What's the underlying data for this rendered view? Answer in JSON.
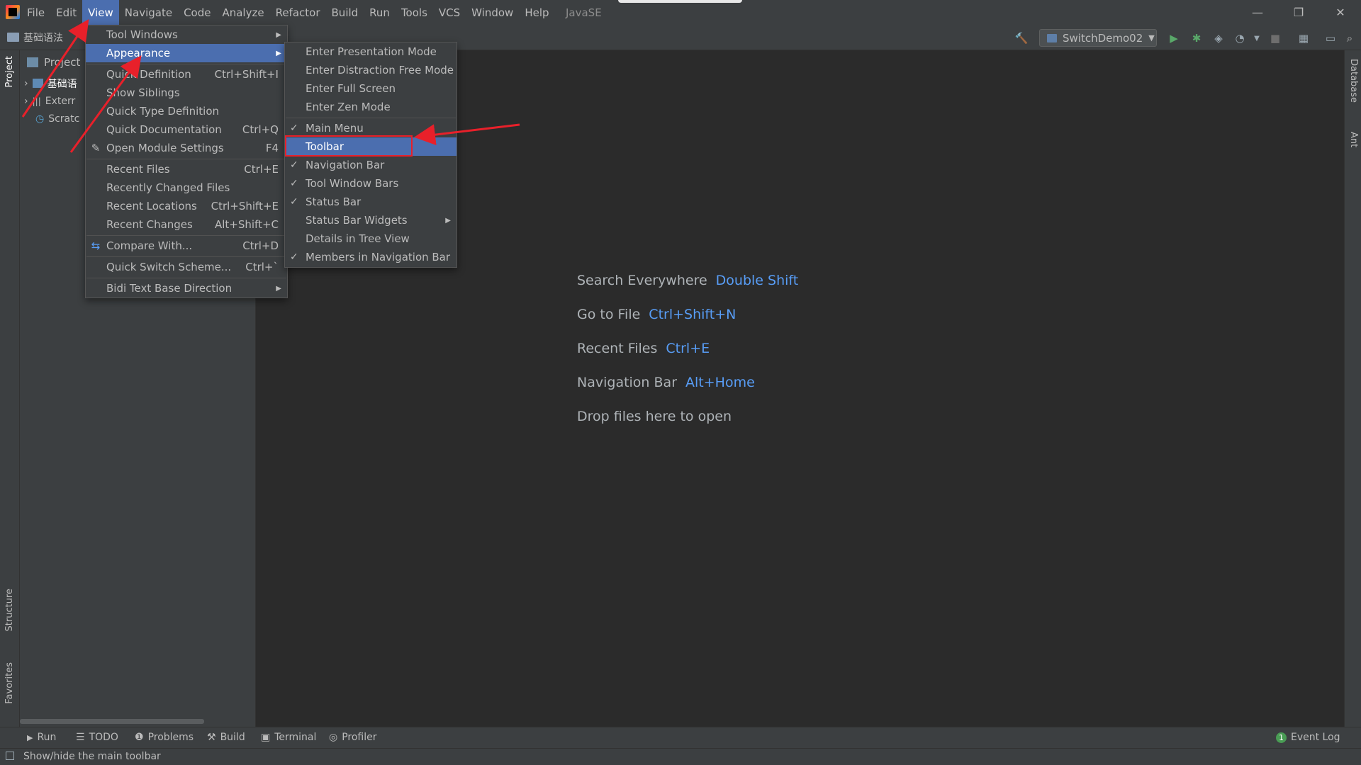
{
  "menubar": {
    "items": [
      "File",
      "Edit",
      "View",
      "Navigate",
      "Code",
      "Analyze",
      "Refactor",
      "Build",
      "Run",
      "Tools",
      "VCS",
      "Window",
      "Help"
    ],
    "active": "View",
    "project_title": "JavaSE"
  },
  "window_controls": {
    "minimize": "—",
    "restore": "❐",
    "close": "✕"
  },
  "navbar": {
    "breadcrumb": "基础语法",
    "run_config": "SwitchDemo02"
  },
  "left_stripe": {
    "project": "Project",
    "structure": "Structure",
    "favorites": "Favorites"
  },
  "right_stripe": {
    "database": "Database",
    "ant": "Ant"
  },
  "project_panel": {
    "header": "Project",
    "tree": [
      "基础语",
      "Exterr",
      "Scratc"
    ]
  },
  "view_menu": {
    "items": [
      {
        "label": "Tool Windows",
        "shortcut": "",
        "submenu": true
      },
      {
        "label": "Appearance",
        "shortcut": "",
        "submenu": true,
        "selected": true
      },
      {
        "label": "Quick Definition",
        "shortcut": "Ctrl+Shift+I"
      },
      {
        "label": "Show Siblings",
        "shortcut": ""
      },
      {
        "label": "Quick Type Definition",
        "shortcut": ""
      },
      {
        "label": "Quick Documentation",
        "shortcut": "Ctrl+Q"
      },
      {
        "label": "Open Module Settings",
        "shortcut": "F4"
      },
      {
        "label": "Recent Files",
        "shortcut": "Ctrl+E"
      },
      {
        "label": "Recently Changed Files",
        "shortcut": ""
      },
      {
        "label": "Recent Locations",
        "shortcut": "Ctrl+Shift+E"
      },
      {
        "label": "Recent Changes",
        "shortcut": "Alt+Shift+C"
      },
      {
        "label": "Compare With...",
        "shortcut": "Ctrl+D"
      },
      {
        "label": "Quick Switch Scheme...",
        "shortcut": "Ctrl+`"
      },
      {
        "label": "Bidi Text Base Direction",
        "shortcut": "",
        "submenu": true
      }
    ]
  },
  "appearance_menu": {
    "items": [
      {
        "label": "Enter Presentation Mode",
        "checked": false
      },
      {
        "label": "Enter Distraction Free Mode",
        "checked": false
      },
      {
        "label": "Enter Full Screen",
        "checked": false
      },
      {
        "label": "Enter Zen Mode",
        "checked": false
      },
      {
        "label": "Main Menu",
        "checked": true
      },
      {
        "label": "Toolbar",
        "checked": false,
        "selected": true
      },
      {
        "label": "Navigation Bar",
        "checked": true
      },
      {
        "label": "Tool Window Bars",
        "checked": true
      },
      {
        "label": "Status Bar",
        "checked": true
      },
      {
        "label": "Status Bar Widgets",
        "checked": false,
        "submenu": true
      },
      {
        "label": "Details in Tree View",
        "checked": false
      },
      {
        "label": "Members in Navigation Bar",
        "checked": true
      }
    ]
  },
  "welcome": {
    "hints": [
      {
        "label": "Search Everywhere",
        "key": "Double Shift"
      },
      {
        "label": "Go to File",
        "key": "Ctrl+Shift+N"
      },
      {
        "label": "Recent Files",
        "key": "Ctrl+E"
      },
      {
        "label": "Navigation Bar",
        "key": "Alt+Home"
      },
      {
        "label": "Drop files here to open",
        "key": ""
      }
    ]
  },
  "toolwindow_bar": {
    "run": "Run",
    "todo": "TODO",
    "problems": "Problems",
    "build": "Build",
    "terminal": "Terminal",
    "profiler": "Profiler",
    "event_log": "Event Log",
    "event_count": "1"
  },
  "status": {
    "text": "Show/hide the main toolbar"
  },
  "colors": {
    "accent": "#4b6eaf",
    "annotation": "#e8202a",
    "link": "#589df6"
  }
}
